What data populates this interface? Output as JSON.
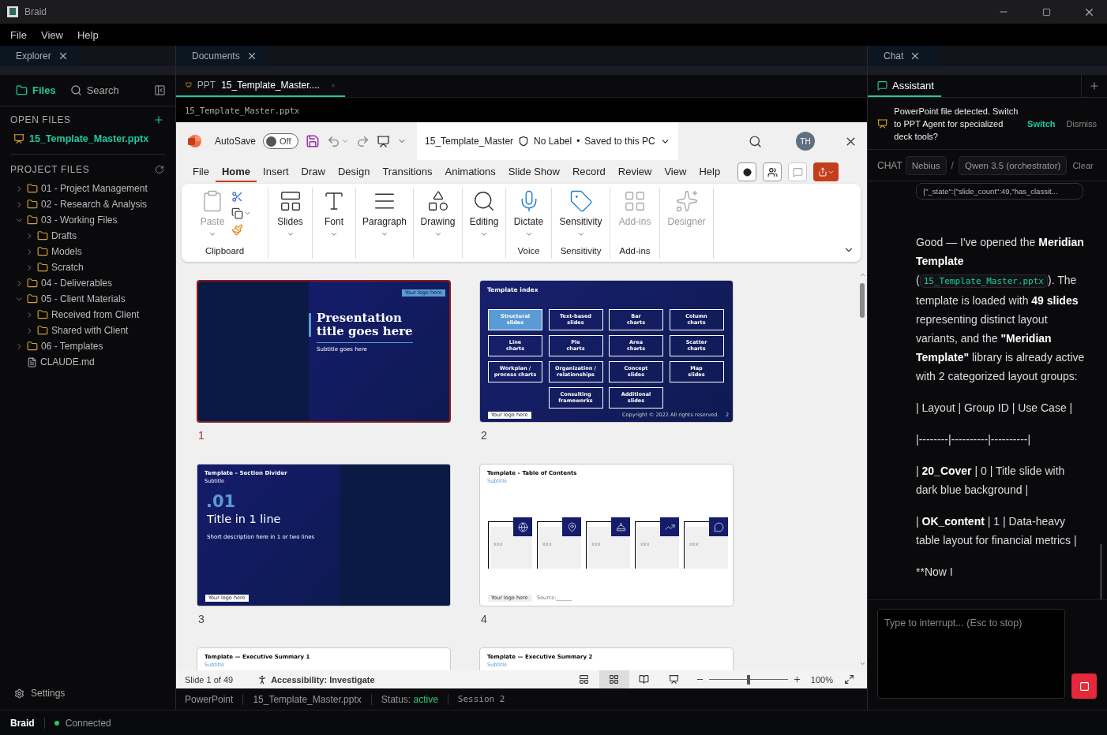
{
  "window": {
    "title": "Braid"
  },
  "menu": [
    "File",
    "View",
    "Help"
  ],
  "explorer": {
    "panel_tab": "Explorer",
    "modes": [
      {
        "label": "Files",
        "selected": true
      },
      {
        "label": "Search",
        "selected": false
      }
    ],
    "open_files_title": "OPEN FILES",
    "open_files": [
      "15_Template_Master.pptx"
    ],
    "project_files_title": "PROJECT FILES",
    "tree": [
      {
        "name": "01 - Project Management",
        "kind": "folder",
        "expanded": false
      },
      {
        "name": "02 - Research & Analysis",
        "kind": "folder",
        "expanded": false
      },
      {
        "name": "03 - Working Files",
        "kind": "folder",
        "expanded": true,
        "children": [
          {
            "name": "Drafts",
            "kind": "folder",
            "expanded": false
          },
          {
            "name": "Models",
            "kind": "folder",
            "expanded": false
          },
          {
            "name": "Scratch",
            "kind": "folder",
            "expanded": false
          }
        ]
      },
      {
        "name": "04 - Deliverables",
        "kind": "folder",
        "expanded": false
      },
      {
        "name": "05 - Client Materials",
        "kind": "folder",
        "expanded": true,
        "children": [
          {
            "name": "Received from Client",
            "kind": "folder",
            "expanded": false
          },
          {
            "name": "Shared with Client",
            "kind": "folder",
            "expanded": false
          }
        ]
      },
      {
        "name": "06 - Templates",
        "kind": "folder",
        "expanded": false
      },
      {
        "name": "CLAUDE.md",
        "kind": "file"
      }
    ],
    "settings": "Settings"
  },
  "documents": {
    "panel_tab": "Documents",
    "tab": {
      "type": "PPT",
      "title": "15_Template_Master....",
      "selected": true
    },
    "path": "15_Template_Master.pptx",
    "ppt": {
      "autosave_label": "AutoSave",
      "autosave": {
        "on": false,
        "label": "Off"
      },
      "file_name": "15_Template_Master",
      "sensitivity": "No Label",
      "separator": "•",
      "save_state": "Saved to this PC",
      "user": "TH",
      "tabs": [
        {
          "label": "File",
          "selected": false
        },
        {
          "label": "Home",
          "selected": true
        },
        {
          "label": "Insert",
          "selected": false
        },
        {
          "label": "Draw",
          "selected": false
        },
        {
          "label": "Design",
          "selected": false
        },
        {
          "label": "Transitions",
          "selected": false
        },
        {
          "label": "Animations",
          "selected": false
        },
        {
          "label": "Slide Show",
          "selected": false
        },
        {
          "label": "Record",
          "selected": false
        },
        {
          "label": "Review",
          "selected": false
        },
        {
          "label": "View",
          "selected": false
        },
        {
          "label": "Help",
          "selected": false
        }
      ],
      "ribbon": [
        {
          "label": "Clipboard",
          "buttons": [
            {
              "label": "Paste",
              "disabled": true
            }
          ]
        },
        {
          "buttons": [
            {
              "label": "Slides",
              "disabled": false
            }
          ]
        },
        {
          "buttons": [
            {
              "label": "Font",
              "disabled": false
            }
          ]
        },
        {
          "buttons": [
            {
              "label": "Paragraph",
              "disabled": false
            }
          ]
        },
        {
          "buttons": [
            {
              "label": "Drawing",
              "disabled": false
            }
          ]
        },
        {
          "buttons": [
            {
              "label": "Editing",
              "disabled": false
            }
          ]
        },
        {
          "label": "Voice",
          "buttons": [
            {
              "label": "Dictate",
              "disabled": false
            }
          ]
        },
        {
          "label": "Sensitivity",
          "buttons": [
            {
              "label": "Sensitivity",
              "disabled": false
            }
          ]
        },
        {
          "label": "Add-ins",
          "buttons": [
            {
              "label": "Add-ins",
              "disabled": true
            }
          ]
        },
        {
          "buttons": [
            {
              "label": "Designer",
              "disabled": true
            }
          ]
        }
      ],
      "slides": [
        {
          "number": "1",
          "selected": true,
          "kind": "title",
          "title": "Presentation title goes here",
          "subtitle": "Subtitle goes here",
          "logo": "Your logo here"
        },
        {
          "number": "2",
          "selected": false,
          "kind": "index",
          "title": "Template index",
          "cells": [
            {
              "label": "Structural\nslides",
              "selected": true
            },
            {
              "label": "Text-based\nslides",
              "selected": false
            },
            {
              "label": "Bar\ncharts",
              "selected": false
            },
            {
              "label": "Column\ncharts",
              "selected": false
            },
            {
              "label": "Line\ncharts",
              "selected": false
            },
            {
              "label": "Pie\ncharts",
              "selected": false
            },
            {
              "label": "Area\ncharts",
              "selected": false
            },
            {
              "label": "Scatter\ncharts",
              "selected": false
            },
            {
              "label": "Workplan /\nprocess charts",
              "selected": false
            },
            {
              "label": "Organization /\nrelationships",
              "selected": false
            },
            {
              "label": "Concept\nslides",
              "selected": false
            },
            {
              "label": "Map\nslides",
              "selected": false
            },
            {
              "label": "Consulting\nframeworks",
              "selected": false
            },
            {
              "label": "Additional\nslides",
              "selected": false
            }
          ],
          "logo": "Your logo here",
          "copyright": "Copyright © 2022 All rights reserved.",
          "page": "2"
        },
        {
          "number": "3",
          "selected": false,
          "kind": "section",
          "title": "Template – Section Divider",
          "subtitle": "Subtitle",
          "index": ".01",
          "heading": "Title in 1 line",
          "description": "Short description here in 1 or two lines",
          "logo": "Your logo here"
        },
        {
          "number": "4",
          "selected": false,
          "kind": "toc",
          "title": "Template – Table of Contents",
          "subtitle": "Subtitle",
          "cards": [
            "xxx",
            "xxx",
            "xxx",
            "xxx",
            "xxx"
          ],
          "logo": "Your logo here",
          "source": "Source:______"
        },
        {
          "selected": false,
          "kind": "plain",
          "title": "Template — Executive Summary 1",
          "subtitle": "Subtitle"
        },
        {
          "selected": false,
          "kind": "plain",
          "title": "Template — Executive Summary 2",
          "subtitle": "Subtitle"
        }
      ],
      "status": {
        "slide": "Slide 1 of 49",
        "accessibility": "Accessibility: Investigate",
        "views": [
          {
            "selected": false
          },
          {
            "selected": true
          },
          {
            "selected": false
          },
          {
            "selected": false
          }
        ],
        "zoom": {
          "level": 0.5,
          "label": "100%"
        }
      }
    },
    "doc_status": {
      "app": "PowerPoint",
      "file": "15_Template_Master.pptx",
      "status_label": "Status:",
      "status": "active",
      "session": "Session 2"
    }
  },
  "chat": {
    "panel_tab": "Chat",
    "tab": {
      "label": "Assistant",
      "selected": true
    },
    "notice": {
      "text": "PowerPoint file detected. Switch to PPT Agent for specialized deck tools?",
      "switch": "Switch",
      "dismiss": "Dismiss"
    },
    "header": {
      "label": "CHAT",
      "provider": "Nebius",
      "separator": "/",
      "model": "Qwen 3.5 (orchestrator)",
      "clear": "Clear"
    },
    "tool_output": "{\"_state\":{\"slide_count\":49,\"has_classit...",
    "message": [
      {
        "segments": [
          {
            "kind": "text",
            "text": "Good — I've opened the "
          },
          {
            "kind": "bold",
            "text": "Meridian Template"
          },
          {
            "kind": "text",
            "text": " ("
          },
          {
            "kind": "code",
            "text": "15_Template_Master.pptx"
          },
          {
            "kind": "text",
            "text": "). The template is loaded with "
          },
          {
            "kind": "bold",
            "text": "49 slides"
          },
          {
            "kind": "text",
            "text": " representing distinct layout variants, and the "
          },
          {
            "kind": "bold",
            "text": "\"Meridian Template\""
          },
          {
            "kind": "text",
            "text": " library is already active with 2 categorized layout groups:"
          }
        ]
      },
      {
        "segments": [
          {
            "kind": "text",
            "text": "| Layout | Group ID | Use Case |"
          }
        ]
      },
      {
        "segments": [
          {
            "kind": "text",
            "text": "|--------|----------|----------|"
          }
        ]
      },
      {
        "segments": [
          {
            "kind": "text",
            "text": "| "
          },
          {
            "kind": "bold",
            "text": "20_Cover"
          },
          {
            "kind": "text",
            "text": " | 0 | Title slide with dark blue background |"
          }
        ]
      },
      {
        "segments": [
          {
            "kind": "text",
            "text": "| "
          },
          {
            "kind": "bold",
            "text": "OK_content"
          },
          {
            "kind": "text",
            "text": " | 1 | Data-heavy table layout for financial metrics |"
          }
        ]
      },
      {
        "segments": [
          {
            "kind": "text",
            "text": "**Now I"
          }
        ]
      }
    ],
    "input": {
      "placeholder": "Type to interrupt... (Esc to stop)"
    }
  },
  "status_bar": {
    "app": "Braid",
    "connection": "Connected"
  }
}
